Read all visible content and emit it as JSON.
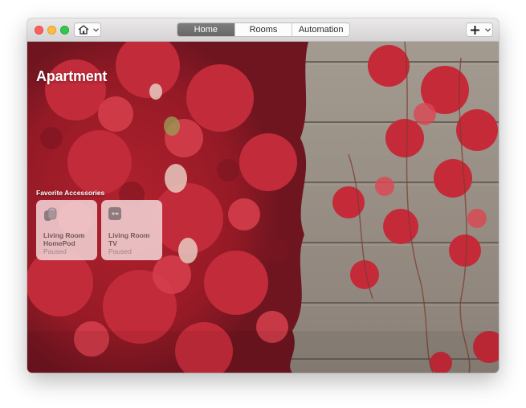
{
  "toolbar": {
    "home_icon": "house-icon",
    "tabs": [
      {
        "label": "Home",
        "active": true
      },
      {
        "label": "Rooms",
        "active": false
      },
      {
        "label": "Automation",
        "active": false
      }
    ],
    "add_icon": "plus-icon"
  },
  "main": {
    "title": "Apartment",
    "favorites_label": "Favorite Accessories",
    "accessories": [
      {
        "name": "Living Room HomePod",
        "status": "Paused",
        "icon": "homepod-icon"
      },
      {
        "name": "Living Room TV",
        "status": "Paused",
        "icon": "apple-tv-icon"
      }
    ]
  },
  "colors": {
    "active_tab": "#737273",
    "tile_bg": "#f0cdcf",
    "leaf_red": "#c12a3a"
  }
}
